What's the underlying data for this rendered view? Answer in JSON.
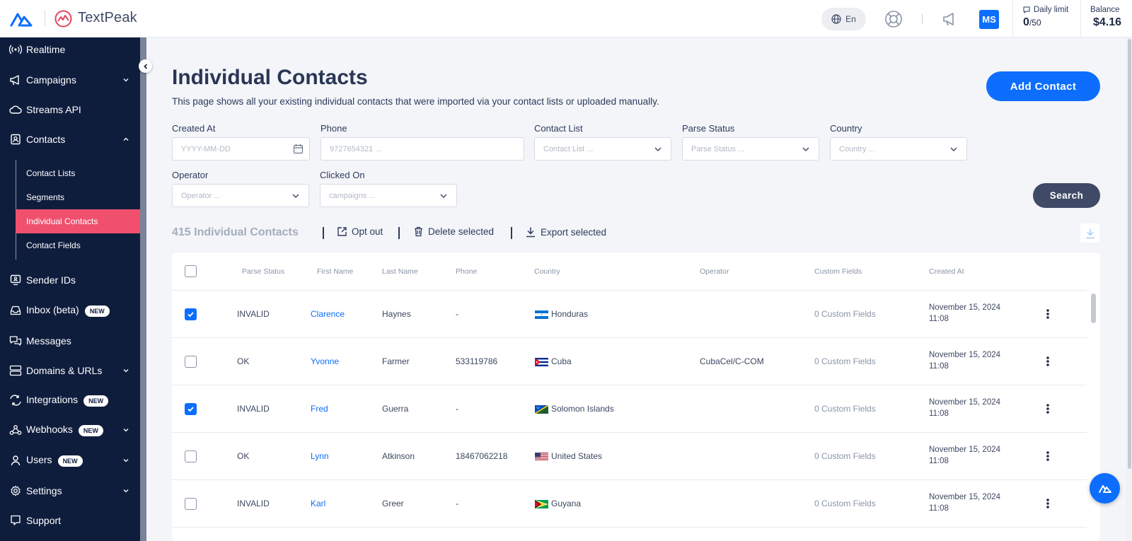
{
  "header": {
    "brand": "TextPeak",
    "language": "En",
    "avatar_initials": "MS",
    "daily_limit_label": "Daily limit",
    "daily_limit_used": "0",
    "daily_limit_total": "/50",
    "balance_label": "Balance",
    "balance_value": "$4.16"
  },
  "sidebar": {
    "items": [
      {
        "label": "Realtime",
        "icon": "realtime-icon"
      },
      {
        "label": "Campaigns",
        "icon": "megaphone-icon"
      },
      {
        "label": "Streams API",
        "icon": "cloud-icon"
      },
      {
        "label": "Contacts",
        "icon": "contacts-icon"
      },
      {
        "label": "Sender IDs",
        "icon": "sender-id-icon"
      },
      {
        "label": "Inbox (beta)",
        "icon": "inbox-icon",
        "badge": "NEW"
      },
      {
        "label": "Messages",
        "icon": "messages-icon"
      },
      {
        "label": "Domains & URLs",
        "icon": "domains-icon"
      },
      {
        "label": "Integrations",
        "icon": "integrations-icon",
        "badge": "NEW"
      },
      {
        "label": "Webhooks",
        "icon": "webhooks-icon",
        "badge": "NEW"
      },
      {
        "label": "Users",
        "icon": "user-icon",
        "badge": "NEW"
      },
      {
        "label": "Settings",
        "icon": "settings-icon"
      },
      {
        "label": "Support",
        "icon": "support-icon"
      }
    ],
    "contacts_sub": [
      "Contact Lists",
      "Segments",
      "Individual Contacts",
      "Contact Fields"
    ]
  },
  "main": {
    "title": "Individual Contacts",
    "description": "This page shows all your existing individual contacts that were imported via your contact lists or uploaded manually.",
    "add_button": "Add Contact",
    "filters": {
      "created_at": {
        "label": "Created At",
        "placeholder": "YYYY-MM-DD"
      },
      "phone": {
        "label": "Phone",
        "placeholder": "9727654321 ..."
      },
      "contact_list": {
        "label": "Contact List",
        "placeholder": "Contact List ..."
      },
      "parse_status": {
        "label": "Parse Status",
        "placeholder": "Parse Status ..."
      },
      "country": {
        "label": "Country",
        "placeholder": "Country ..."
      },
      "operator": {
        "label": "Operator",
        "placeholder": "Operator ..."
      },
      "clicked_on": {
        "label": "Clicked On",
        "placeholder": "campaigns ..."
      }
    },
    "search_button": "Search",
    "count_label": "415 Individual Contacts",
    "actions": {
      "opt_out": "Opt out",
      "delete_selected": "Delete selected",
      "export_selected": "Export selected"
    }
  },
  "table": {
    "columns": [
      "Parse Status",
      "First Name",
      "Last Name",
      "Phone",
      "Country",
      "Operator",
      "Custom Fields",
      "Created At"
    ],
    "rows": [
      {
        "checked": true,
        "status": "INVALID",
        "first": "Clarence",
        "last": "Haynes",
        "phone": "-",
        "country": "Honduras",
        "flag": "honduras",
        "operator": "",
        "custom": "0 Custom Fields",
        "date": "November 15, 2024",
        "time": "11:08"
      },
      {
        "checked": false,
        "status": "OK",
        "first": "Yvonne",
        "last": "Farmer",
        "phone": "533119786",
        "country": "Cuba",
        "flag": "cuba",
        "operator": "CubaCel/C-COM",
        "custom": "0 Custom Fields",
        "date": "November 15, 2024",
        "time": "11:08"
      },
      {
        "checked": true,
        "status": "INVALID",
        "first": "Fred",
        "last": "Guerra",
        "phone": "-",
        "country": "Solomon Islands",
        "flag": "solomon",
        "operator": "",
        "custom": "0 Custom Fields",
        "date": "November 15, 2024",
        "time": "11:08"
      },
      {
        "checked": false,
        "status": "OK",
        "first": "Lynn",
        "last": "Atkinson",
        "phone": "18467062218",
        "country": "United States",
        "flag": "us",
        "operator": "",
        "custom": "0 Custom Fields",
        "date": "November 15, 2024",
        "time": "11:08"
      },
      {
        "checked": false,
        "status": "INVALID",
        "first": "Karl",
        "last": "Greer",
        "phone": "-",
        "country": "Guyana",
        "flag": "guyana",
        "operator": "",
        "custom": "0 Custom Fields",
        "date": "November 15, 2024",
        "time": "11:08"
      }
    ]
  },
  "colors": {
    "accent": "#0d6efd",
    "sidebar": "#0f1d3d",
    "active": "#f0506e"
  }
}
